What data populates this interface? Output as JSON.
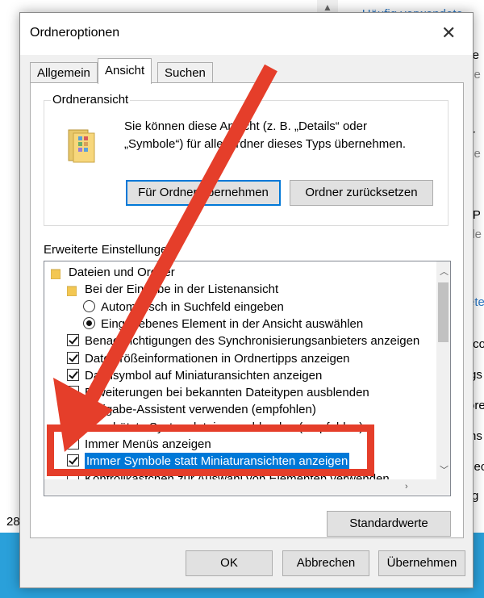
{
  "background": {
    "top_link": "Häufig verwendete",
    "right_fragments": [
      "kte",
      "se",
      "r",
      "se",
      "esP",
      "ale",
      "ete",
      ".co",
      "gs",
      "ore",
      "ns",
      "sec",
      "g"
    ],
    "left_number": "28"
  },
  "dialog": {
    "title": "Ordneroptionen",
    "close_icon": "close-icon",
    "tabs": [
      "Allgemein",
      "Ansicht",
      "Suchen"
    ],
    "active_tab": "Ansicht",
    "folder_view": {
      "title": "Ordneransicht",
      "description_line1": "Sie können diese Ansicht (z. B. „Details“ oder",
      "description_line2": "„Symbole“) für alle Ordner dieses Typs übernehmen.",
      "apply_button": "Für Ordner übernehmen",
      "reset_button": "Ordner zurücksetzen"
    },
    "advanced": {
      "title": "Erweiterte Einstellungen:",
      "items": [
        {
          "type": "folder",
          "label": "Dateien und Ordner"
        },
        {
          "type": "folder",
          "label": "Bei der Eingabe in der Listenansicht"
        },
        {
          "type": "radio",
          "checked": false,
          "label": "Automatisch in Suchfeld eingeben"
        },
        {
          "type": "radio",
          "checked": true,
          "label": "Eingegebenes Element in der Ansicht auswählen"
        },
        {
          "type": "checkbox",
          "checked": true,
          "label": "Benachrichtigungen des Synchronisierungsanbieters anzeigen"
        },
        {
          "type": "checkbox",
          "checked": true,
          "label": "Dateigrößeinformationen in Ordnertipps anzeigen"
        },
        {
          "type": "checkbox",
          "checked": true,
          "label": "Dateisymbol auf Miniaturansichten anzeigen"
        },
        {
          "type": "checkbox",
          "checked": false,
          "label": "Erweiterungen bei bekannten Dateitypen ausblenden"
        },
        {
          "type": "checkbox",
          "checked": true,
          "label": "Freigabe-Assistent verwenden (empfohlen)"
        },
        {
          "type": "checkbox",
          "checked": true,
          "label": "Geschützte Systemdateien ausblenden (empfohlen)"
        },
        {
          "type": "checkbox",
          "checked": false,
          "label": "Immer Menüs anzeigen"
        },
        {
          "type": "checkbox",
          "checked": true,
          "label": "Immer Symbole statt Miniaturansichten anzeigen",
          "selected": true
        },
        {
          "type": "checkbox",
          "checked": false,
          "label": "Kontrollkästchen zur Auswahl von Elementen verwenden"
        }
      ]
    },
    "defaults_button": "Standardwerte",
    "ok_button": "OK",
    "cancel_button": "Abbrechen",
    "apply_button": "Übernehmen"
  },
  "colors": {
    "annotation_red": "#e53e2a",
    "selection_blue": "#0078d7",
    "taskbar_blue": "#2aa0da"
  }
}
